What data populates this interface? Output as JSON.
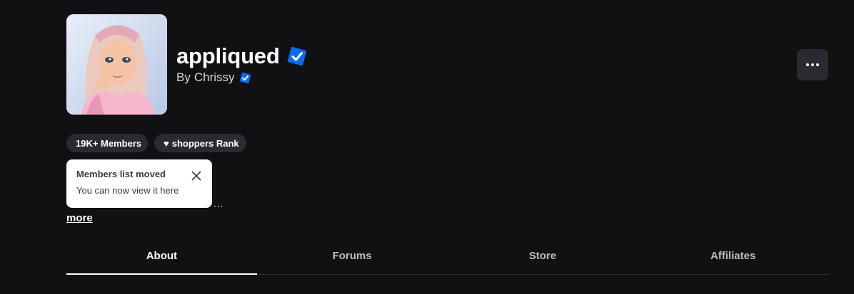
{
  "group": {
    "name": "appliqued",
    "owner_prefix": "By",
    "owner_name": "Chrissy",
    "avatar_icon": "group-avatar-illustration",
    "verified_icon": "verified-badge-icon",
    "verified_color": "#0f6be8"
  },
  "more_options": {
    "icon": "ellipsis-icon"
  },
  "pills": {
    "members": "19K+ Members",
    "rank_symbol": "♥",
    "rank": "shoppers Rank"
  },
  "description": {
    "fragment": "…",
    "more_link": "more"
  },
  "tooltip": {
    "title": "Members list moved",
    "body": "You can now view it here",
    "close_icon": "close-icon"
  },
  "tabs": [
    {
      "label": "About",
      "active": true
    },
    {
      "label": "Forums",
      "active": false
    },
    {
      "label": "Store",
      "active": false
    },
    {
      "label": "Affiliates",
      "active": false
    }
  ],
  "colors": {
    "background": "#111114",
    "pill_bg": "#2a2b30",
    "accent_verified": "#0f6be8"
  }
}
